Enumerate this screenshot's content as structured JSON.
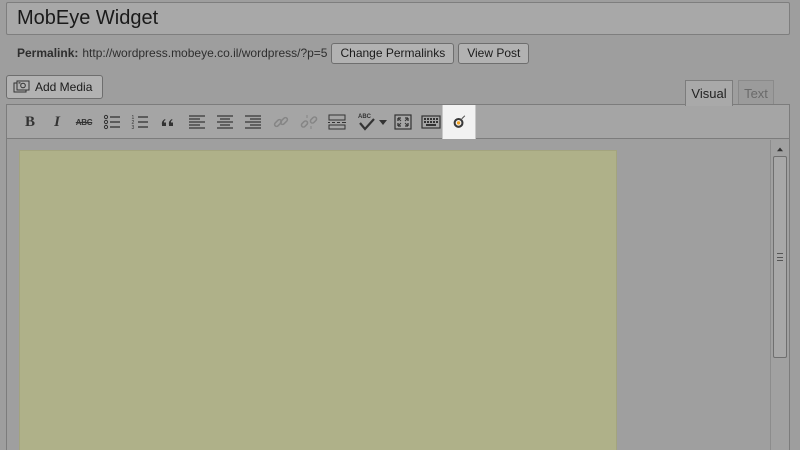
{
  "post": {
    "title": "MobEye Widget"
  },
  "permalink": {
    "label": "Permalink:",
    "url": "http://wordpress.mobeye.co.il/wordpress/?p=5",
    "change_button": "Change Permalinks",
    "view_button": "View Post"
  },
  "media": {
    "add_label": "Add Media",
    "icon": "media-camera-icon"
  },
  "editor_tabs": [
    {
      "label": "Visual",
      "active": true
    },
    {
      "label": "Text",
      "active": false
    }
  ],
  "toolbar": {
    "bold": "B",
    "italic": "I",
    "strike": "ABC",
    "spellcheck": "ABC",
    "icons": [
      "bold-icon",
      "italic-icon",
      "strikethrough-icon",
      "bulleted-list-icon",
      "numbered-list-icon",
      "blockquote-icon",
      "align-left-icon",
      "align-center-icon",
      "align-right-icon",
      "insert-link-icon",
      "remove-link-icon",
      "read-more-icon",
      "spellcheck-icon",
      "dropdown-arrow-icon",
      "fullscreen-icon",
      "kitchen-sink-icon",
      "mobeye-widget-icon"
    ]
  },
  "colors": {
    "editor_paper": "#afb189",
    "page_overlay": "#9e9e9e",
    "highlighted_button": "#f2f2f2"
  }
}
